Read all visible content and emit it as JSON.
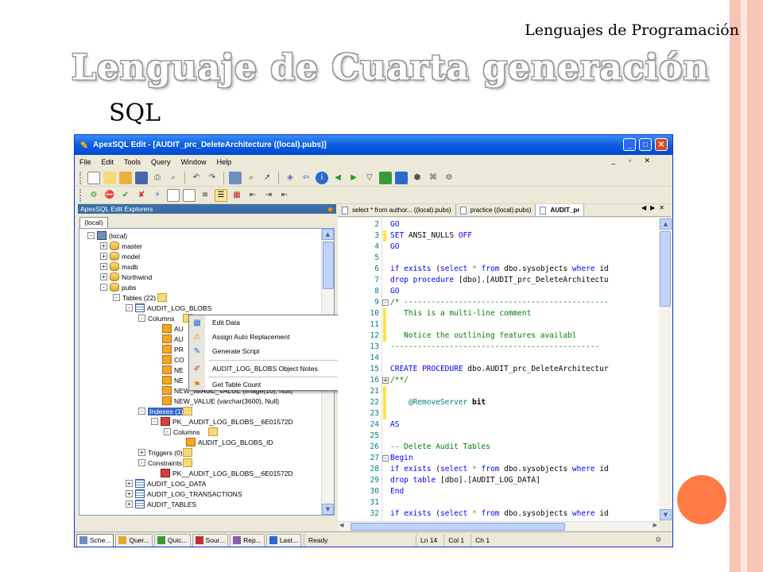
{
  "slide": {
    "header": "Lenguajes de Programación",
    "title": "Lenguaje de Cuarta generación",
    "subtitle": "SQL",
    "accent_color": "#FF7A45",
    "stripe_colors": [
      "#F8C4B4",
      "#FDE7DF"
    ]
  },
  "window": {
    "title": "ApexSQL Edit - [AUDIT_prc_DeleteArchitecture ((local).pubs)]",
    "menu": [
      "File",
      "Edit",
      "Tools",
      "Query",
      "Window",
      "Help"
    ],
    "explorer": {
      "header": "ApexSQL Edit Explorers",
      "tab": "(local)"
    },
    "tree": [
      {
        "label": "(local)",
        "icon": "server-icon",
        "expander": "-"
      },
      {
        "label": "master",
        "icon": "database-icon",
        "expander": "+"
      },
      {
        "label": "model",
        "icon": "database-icon",
        "expander": "+"
      },
      {
        "label": "msdb",
        "icon": "database-icon",
        "expander": "+"
      },
      {
        "label": "Northwind",
        "icon": "database-icon",
        "expander": "+"
      },
      {
        "label": "pubs",
        "icon": "database-icon",
        "expander": "-"
      },
      {
        "label": "Tables (22)",
        "icon": "folder-icon",
        "expander": "-"
      },
      {
        "label": "AUDIT_LOG_BLOBS",
        "icon": "table-icon",
        "expander": "-"
      },
      {
        "label": "Columns",
        "icon": "folder-icon",
        "expander": "-"
      },
      {
        "label": "AU",
        "icon": "column-icon",
        "expander": ""
      },
      {
        "label": "AU",
        "icon": "column-icon",
        "expander": ""
      },
      {
        "label": "PR",
        "icon": "column-icon",
        "expander": ""
      },
      {
        "label": "CO",
        "icon": "column-icon",
        "expander": ""
      },
      {
        "label": "NE",
        "icon": "column-icon",
        "expander": ""
      },
      {
        "label": "NE",
        "icon": "column-icon",
        "expander": ""
      },
      {
        "label": "NEW_IMAGE_VALUE (image(16), Null)",
        "icon": "column-icon",
        "expander": ""
      },
      {
        "label": "NEW_VALUE (varchar(3600), Null)",
        "icon": "column-icon",
        "expander": ""
      },
      {
        "label": "Indexes (1)",
        "icon": "folder-icon",
        "expander": "-"
      },
      {
        "label": "PK__AUDIT_LOG_BLOBS__6E01572D",
        "icon": "key-icon",
        "expander": "-"
      },
      {
        "label": "Columns",
        "icon": "folder-icon",
        "expander": "-"
      },
      {
        "label": "AUDIT_LOG_BLOBS_ID",
        "icon": "column-icon",
        "expander": ""
      },
      {
        "label": "Triggers (0)",
        "icon": "folder-icon",
        "expander": "+"
      },
      {
        "label": "Constraints (1)",
        "icon": "folder-icon",
        "expander": "-"
      },
      {
        "label": "PK__AUDIT_LOG_BLOBS__6E01572D",
        "icon": "key-icon",
        "expander": ""
      },
      {
        "label": "AUDIT_LOG_DATA",
        "icon": "table-icon",
        "expander": "+"
      },
      {
        "label": "AUDIT_LOG_TRANSACTIONS",
        "icon": "table-icon",
        "expander": "+"
      },
      {
        "label": "AUDIT_TABLES",
        "icon": "table-icon",
        "expander": "+"
      }
    ],
    "context_menu": [
      {
        "label": "Edit Data",
        "icon": "grid-icon"
      },
      {
        "label": "Assign Auto Replacement",
        "icon": "warning-icon"
      },
      {
        "label": "Generate Script",
        "icon": "script-icon"
      },
      {
        "label": "AUDIT_LOG_BLOBS Object Notes",
        "icon": "notes-icon"
      },
      {
        "label": "Get Table Count",
        "icon": "count-icon"
      }
    ],
    "doc_tabs": [
      "select * from author... ((local).pubs)",
      "practice ((local).pubs)",
      "AUDIT_pr"
    ],
    "code_lines": [
      {
        "n": "2",
        "t": "GO",
        "c": "kw"
      },
      {
        "n": "3",
        "t": "SET ANSI_NULLS OFF",
        "c": "mix3",
        "y": true
      },
      {
        "n": "4",
        "t": "GO",
        "c": "kw"
      },
      {
        "n": "5",
        "t": "",
        "c": ""
      },
      {
        "n": "6",
        "t": "if exists (select * from dbo.sysobjects where id",
        "c": "mix6"
      },
      {
        "n": "7",
        "t": "drop procedure [dbo].[AUDIT_prc_DeleteArchitectu",
        "c": "mix7"
      },
      {
        "n": "8",
        "t": "GO",
        "c": "kw"
      },
      {
        "n": "9",
        "t": "/* ---------------------------------------------",
        "c": "cm",
        "fold": "-"
      },
      {
        "n": "10",
        "t": "   This is a multi-line comment",
        "c": "cm",
        "y": true
      },
      {
        "n": "11",
        "t": "",
        "c": "",
        "y": true
      },
      {
        "n": "12",
        "t": "   Notice the outlining features availabl",
        "c": "cm",
        "y": true
      },
      {
        "n": "13",
        "t": "----------------------------------------------",
        "c": "cm"
      },
      {
        "n": "14",
        "t": "",
        "c": ""
      },
      {
        "n": "15",
        "t": "CREATE PROCEDURE dbo.AUDIT_prc_DeleteArchitectur",
        "c": "mix15"
      },
      {
        "n": "16",
        "t": "/**/",
        "c": "cm",
        "fold": "+"
      },
      {
        "n": "21",
        "t": "",
        "c": "",
        "y": true
      },
      {
        "n": "22",
        "t": "    @RemoveServer bit",
        "c": "mix22",
        "y": true
      },
      {
        "n": "23",
        "t": "",
        "c": "",
        "y": true
      },
      {
        "n": "24",
        "t": "AS",
        "c": "kw"
      },
      {
        "n": "25",
        "t": "",
        "c": ""
      },
      {
        "n": "26",
        "t": "-- Delete Audit Tables",
        "c": "cm"
      },
      {
        "n": "27",
        "t": "Begin",
        "c": "kw",
        "fold": "-"
      },
      {
        "n": "28",
        "t": "if exists (select * from dbo.sysobjects where id",
        "c": "mix6"
      },
      {
        "n": "29",
        "t": "drop table [dbo].[AUDIT_LOG_DATA]",
        "c": "mix29"
      },
      {
        "n": "30",
        "t": "End",
        "c": "kw"
      },
      {
        "n": "31",
        "t": "",
        "c": ""
      },
      {
        "n": "32",
        "t": "if exists (select * from dbo.sysobjects where id",
        "c": "mix6"
      }
    ],
    "bottom_tabs": [
      "Sche...",
      "Quer...",
      "Quic...",
      "Sour...",
      "Rep...",
      "Last..."
    ],
    "status": {
      "ready": "Ready",
      "ln": "Ln 14",
      "col": "Col 1",
      "ch": "Ch 1"
    }
  }
}
